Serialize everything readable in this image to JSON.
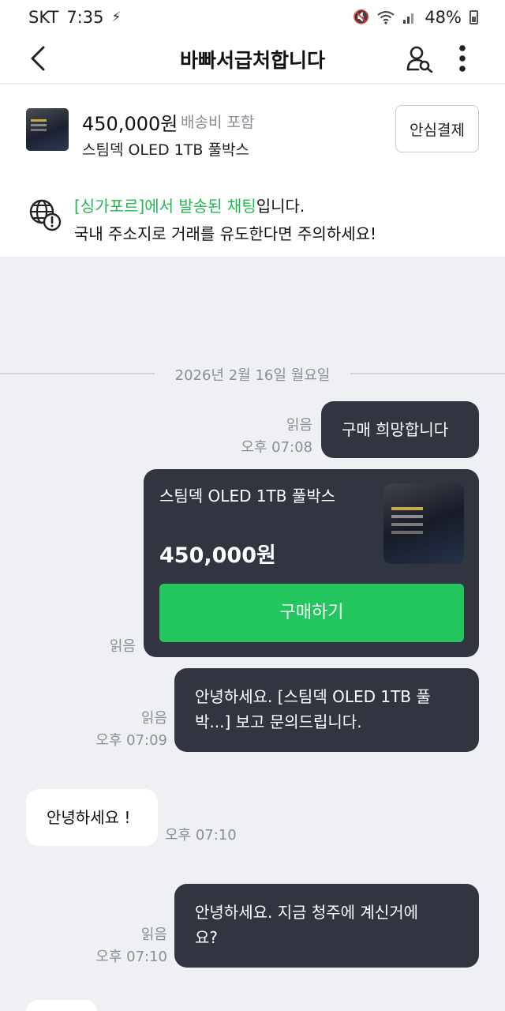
{
  "status_bar": {
    "carrier": "SKT",
    "time": "7:35",
    "battery": "48%"
  },
  "header": {
    "title": "바빠서급처합니다"
  },
  "product": {
    "price": "450,000원",
    "shipping_note": "배송비 포함",
    "name": "스팀덱 OLED 1TB 풀박스",
    "safe_pay_label": "안심결제"
  },
  "notice": {
    "highlight": "[싱가포르]에서 발송된 채팅",
    "line1_suffix": "입니다.",
    "line2": "국내 주소지로 거래를 유도한다면 주의하세요!"
  },
  "date_divider": "2026년 2월 16일 월요일",
  "messages": [
    {
      "side": "me",
      "text": "구매 희망합니다",
      "read": "읽음",
      "time": "오후 07:08"
    },
    {
      "side": "me",
      "type": "product_card",
      "title": "스팀덱 OLED 1TB 풀박스",
      "price": "450,000원",
      "button": "구매하기",
      "read": "읽음"
    },
    {
      "side": "me",
      "text_line1": "안녕하세요. [스팀덱 OLED 1TB 풀",
      "text_line2": "박...] 보고 문의드립니다.",
      "read": "읽음",
      "time": "오후 07:09"
    },
    {
      "side": "them",
      "text": "안녕하세요 !",
      "time": "오후 07:10"
    },
    {
      "side": "me",
      "text_line1": "안녕하세요. 지금 청주에 계신거에",
      "text_line2": "요?",
      "read": "읽음",
      "time": "오후 07:10"
    }
  ]
}
